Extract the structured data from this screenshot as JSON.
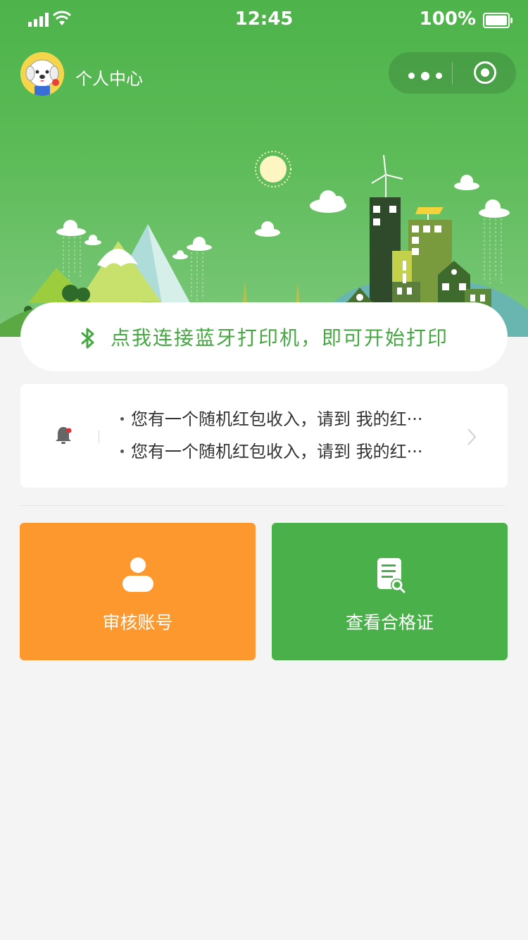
{
  "status_bar": {
    "time": "12:45",
    "battery": "100%"
  },
  "nav": {
    "title": "个人中心"
  },
  "bluetooth": {
    "label": "点我连接蓝牙打印机，即可开始打印"
  },
  "notices": [
    "您有一个随机红包收入，请到 我的红···",
    "您有一个随机红包收入，请到 我的红···"
  ],
  "tiles": [
    {
      "label": "审核账号",
      "icon": "user-icon",
      "color": "#fd982e"
    },
    {
      "label": "查看合格证",
      "icon": "document-search-icon",
      "color": "#4ab04a"
    }
  ],
  "colors": {
    "header_green": "#4db34a",
    "accent_green": "#45a842",
    "orange": "#fd982e"
  }
}
